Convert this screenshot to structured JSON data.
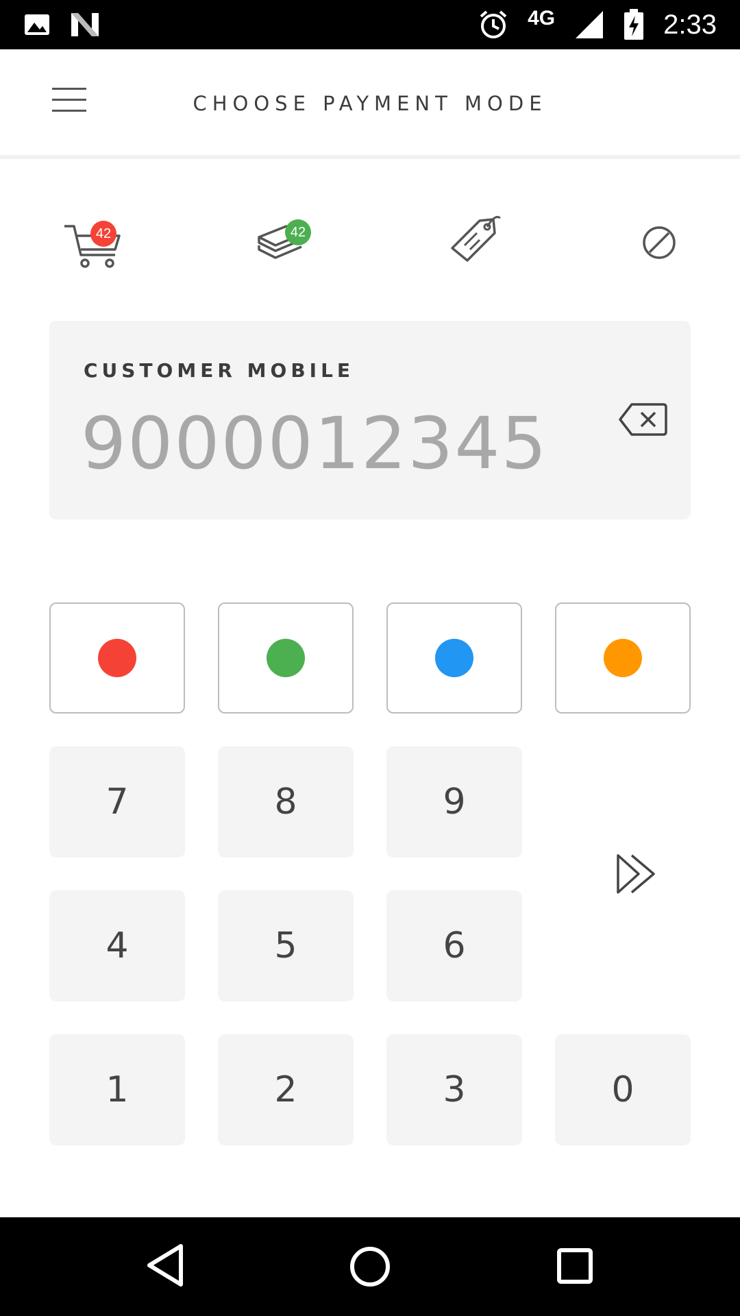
{
  "status_bar": {
    "network": "4G",
    "time": "2:33",
    "icons": [
      "image-icon",
      "n-logo-icon",
      "alarm-icon",
      "signal-icon",
      "battery-charging-icon"
    ]
  },
  "header": {
    "title": "CHOOSE PAYMENT MODE",
    "menu_icon": "hamburger-menu-icon"
  },
  "tabs": [
    {
      "name": "cart",
      "icon": "cart-icon",
      "badge": "42",
      "badge_color": "#f44336"
    },
    {
      "name": "stack",
      "icon": "layers-icon",
      "badge": "42",
      "badge_color": "#4caf50"
    },
    {
      "name": "tag",
      "icon": "tag-icon"
    },
    {
      "name": "cancel",
      "icon": "cancel-icon"
    }
  ],
  "customer": {
    "label": "CUSTOMER MOBILE",
    "value": "9000012345",
    "backspace_icon": "backspace-icon"
  },
  "color_keys": [
    "#f44336",
    "#4caf50",
    "#2196f3",
    "#ff9800"
  ],
  "keypad": {
    "row1": [
      "7",
      "8",
      "9"
    ],
    "row2": [
      "4",
      "5",
      "6"
    ],
    "row3": [
      "1",
      "2",
      "3",
      "0"
    ],
    "next_icon": "fast-forward-icon"
  },
  "nav_bar": {
    "icons": [
      "back-icon",
      "home-icon",
      "recents-icon"
    ]
  }
}
